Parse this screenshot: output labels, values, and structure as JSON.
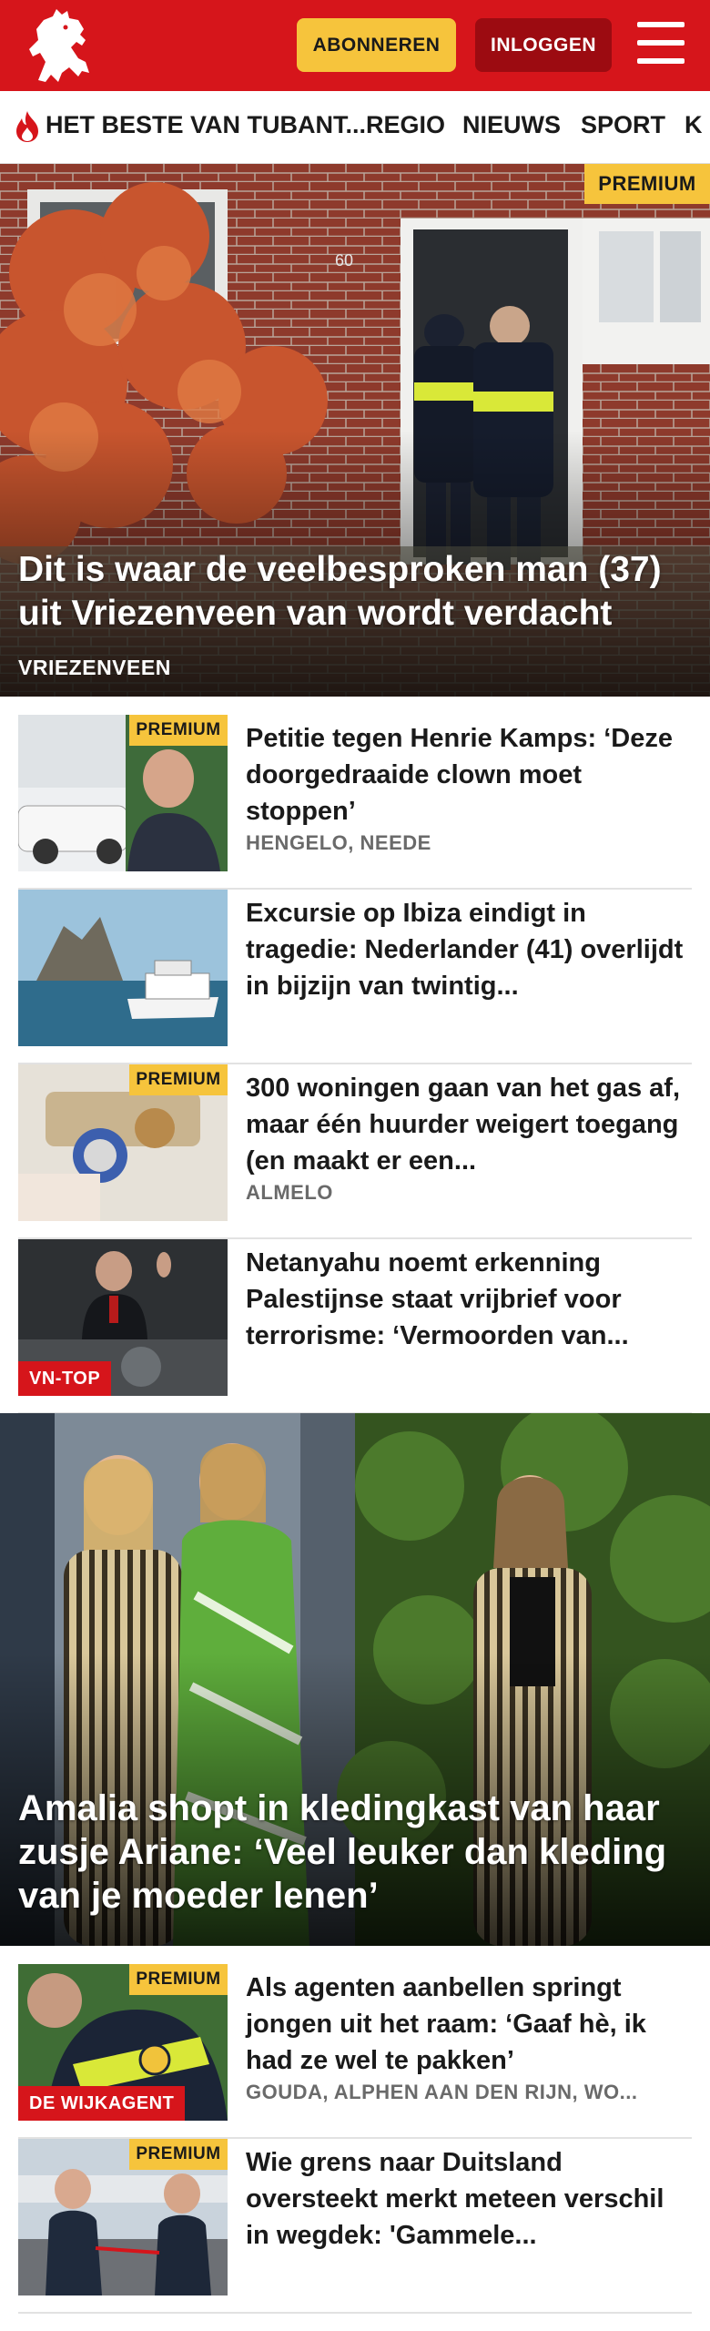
{
  "header": {
    "subscribe_label": "ABONNEREN",
    "login_label": "INLOGGEN",
    "brand_color": "#d6151b",
    "accent_color": "#f6c43c",
    "logo_icon": "horse-logo-icon",
    "menu_icon": "hamburger-menu-icon"
  },
  "nav": {
    "items": [
      {
        "label": "HET BESTE VAN TUBANT..."
      },
      {
        "label": "REGIO"
      },
      {
        "label": "NIEUWS"
      },
      {
        "label": "SPORT"
      },
      {
        "label": "K"
      }
    ],
    "trending_icon": "flame-icon"
  },
  "hero": {
    "badge": "PREMIUM",
    "title": "Dit is waar de veelbesproken man (37) uit Vriezenveen van wordt verdacht",
    "location": "VRIEZENVEEN"
  },
  "articles": [
    {
      "badge": "PREMIUM",
      "title": "Petitie tegen Henrie Kamps: ‘Deze doorgedraaide clown moet stoppen’",
      "location": "HENGELO, NEEDE"
    },
    {
      "title": "Excursie op Ibiza eindigt in tragedie: Nederlander (41) overlijdt in bijzijn van twintig..."
    },
    {
      "badge": "PREMIUM",
      "title": "300 woningen gaan van het gas af, maar één huurder weigert toegang (en maakt er een...",
      "location": "ALMELO"
    },
    {
      "tag": "VN-TOP",
      "title": "Netanyahu noemt erkenning Palestijnse staat vrijbrief voor terrorisme: ‘Vermoorden van..."
    }
  ],
  "feature": {
    "title": "Amalia shopt in kledingkast van haar zusje Ariane: ‘Veel leuker dan kleding van je moeder lenen’"
  },
  "articles2": [
    {
      "badge": "PREMIUM",
      "tag": "DE WIJKAGENT",
      "title": "Als agenten aanbellen springt jongen uit het raam: ‘Gaaf hè, ik had ze wel te pakken’",
      "location": "GOUDA, ALPHEN AAN DEN RIJN, WO..."
    },
    {
      "badge": "PREMIUM",
      "title": "Wie grens naar Duitsland oversteekt merkt meteen verschil in wegdek: 'Gammele..."
    }
  ]
}
